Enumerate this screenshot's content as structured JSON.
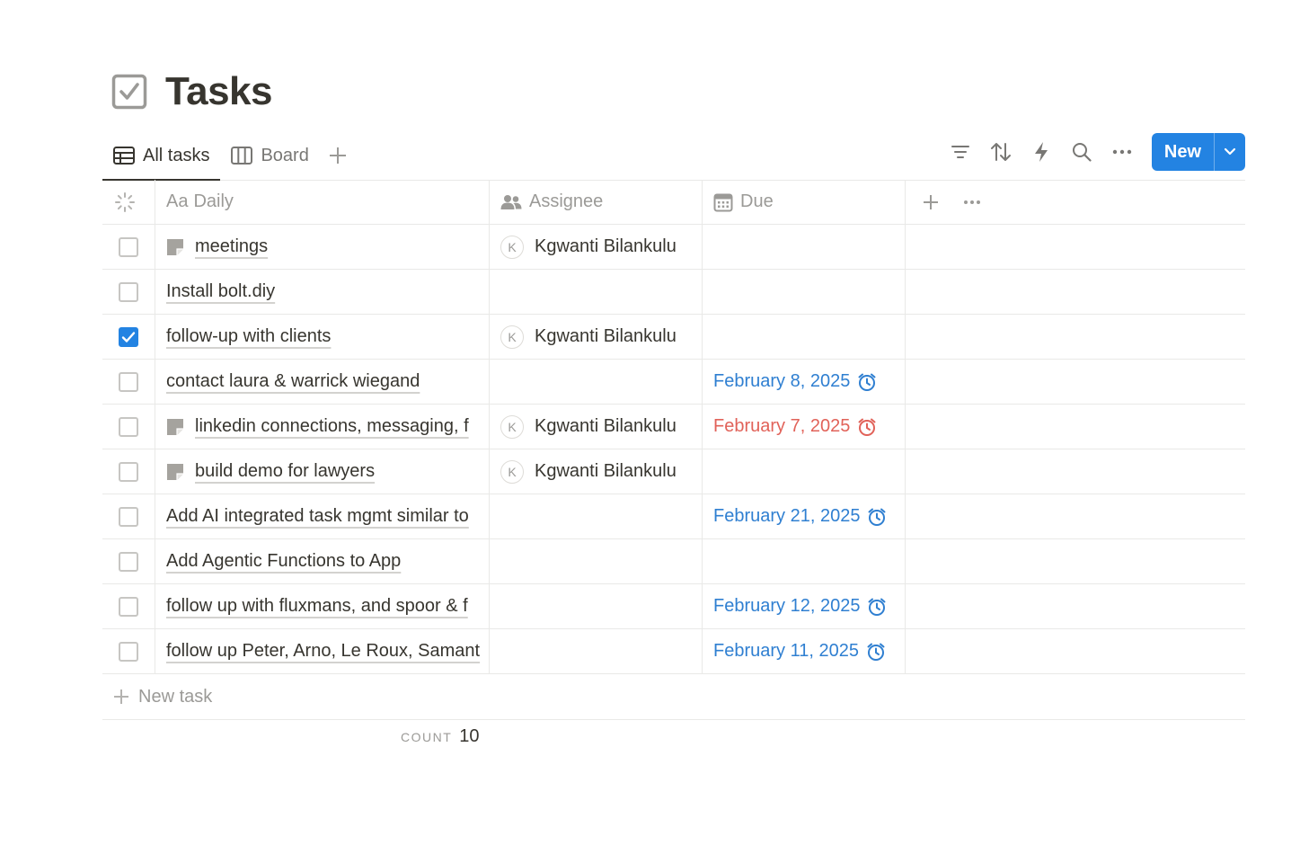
{
  "page": {
    "title": "Tasks",
    "icon": "checkbox-icon"
  },
  "views": {
    "tabs": [
      {
        "label": "All tasks",
        "icon": "table-icon",
        "active": true
      },
      {
        "label": "Board",
        "icon": "board-icon",
        "active": false
      }
    ],
    "add_view_icon": "plus-icon"
  },
  "toolbar": {
    "icons": [
      "filter-icon",
      "sort-icon",
      "lightning-icon",
      "search-icon",
      "more-icon"
    ],
    "new_label": "New",
    "new_dropdown_icon": "chevron-down-icon"
  },
  "columns": {
    "daily": {
      "label": "Daily",
      "prefix": "Aa"
    },
    "assignee": {
      "label": "Assignee",
      "icon": "people-icon"
    },
    "due": {
      "label": "Due",
      "icon": "calendar-icon"
    }
  },
  "rows": [
    {
      "checked": false,
      "has_doc": true,
      "title": "meetings",
      "assignee": "Kgwanti Bilankulu",
      "avatar": "K",
      "due": "",
      "due_status": ""
    },
    {
      "checked": false,
      "has_doc": false,
      "title": "Install bolt.diy",
      "assignee": "",
      "avatar": "",
      "due": "",
      "due_status": ""
    },
    {
      "checked": true,
      "has_doc": false,
      "title": "follow-up with clients",
      "assignee": "Kgwanti Bilankulu",
      "avatar": "K",
      "due": "",
      "due_status": ""
    },
    {
      "checked": false,
      "has_doc": false,
      "title": "contact laura & warrick wiegand",
      "assignee": "",
      "avatar": "",
      "due": "February 8, 2025",
      "due_status": "upcoming"
    },
    {
      "checked": false,
      "has_doc": true,
      "title": "linkedin connections, messaging, f",
      "assignee": "Kgwanti Bilankulu",
      "avatar": "K",
      "due": "February 7, 2025",
      "due_status": "overdue"
    },
    {
      "checked": false,
      "has_doc": true,
      "title": "build demo for lawyers",
      "assignee": "Kgwanti Bilankulu",
      "avatar": "K",
      "due": "",
      "due_status": ""
    },
    {
      "checked": false,
      "has_doc": false,
      "title": "Add AI integrated task mgmt similar to",
      "assignee": "",
      "avatar": "",
      "due": "February 21, 2025",
      "due_status": "upcoming"
    },
    {
      "checked": false,
      "has_doc": false,
      "title": "Add Agentic Functions to App",
      "assignee": "",
      "avatar": "",
      "due": "",
      "due_status": ""
    },
    {
      "checked": false,
      "has_doc": false,
      "title": "follow up with fluxmans, and spoor & f",
      "assignee": "",
      "avatar": "",
      "due": "February 12, 2025",
      "due_status": "upcoming"
    },
    {
      "checked": false,
      "has_doc": false,
      "title": "follow up Peter, Arno, Le Roux, Samant",
      "assignee": "",
      "avatar": "",
      "due": "February 11, 2025",
      "due_status": "upcoming"
    }
  ],
  "new_task_label": "New task",
  "footer": {
    "count_label": "COUNT",
    "count_value": "10"
  },
  "colors": {
    "accent": "#2383e2",
    "overdue": "#e16259",
    "upcoming": "#2f7fd1",
    "text": "#37352f",
    "muted": "#9b9a97",
    "border": "#e9e9e7"
  }
}
